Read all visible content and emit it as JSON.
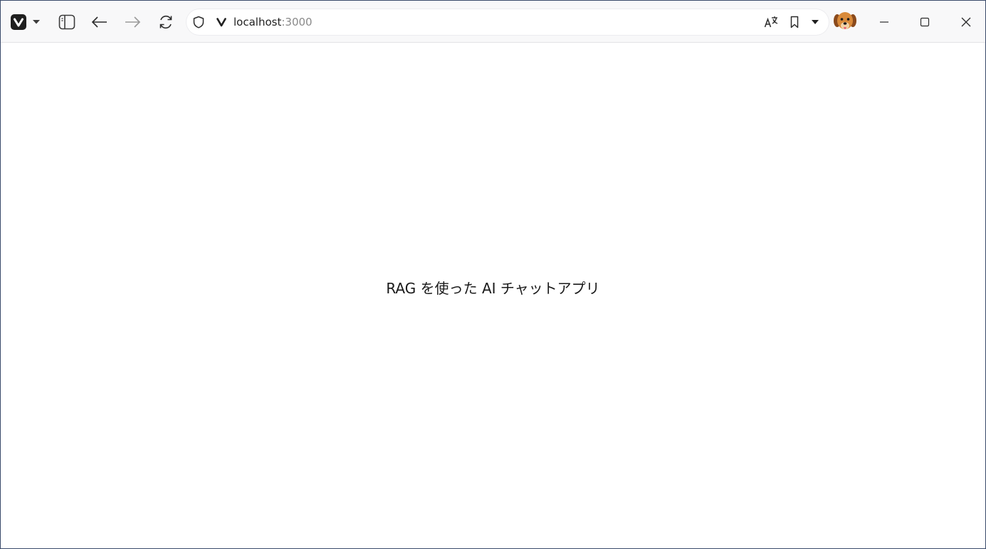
{
  "browser": {
    "address": {
      "host": "localhost",
      "port": ":3000"
    },
    "icons": {
      "menu": "vivaldi-logo-icon",
      "menu_dropdown": "chevron-down-icon",
      "panel": "panel-toggle-icon",
      "back": "arrow-left-icon",
      "forward": "arrow-right-icon",
      "reload": "reload-icon",
      "site_info": "shield-icon",
      "site_logo": "vivaldi-v-icon",
      "translate": "translate-icon",
      "bookmark": "bookmark-icon",
      "bookmark_dropdown": "caret-down-icon",
      "profile": "dog-avatar-icon",
      "minimize": "minimize-icon",
      "maximize": "maximize-icon",
      "close": "close-icon"
    }
  },
  "page": {
    "heading": "RAG を使った AI チャットアプリ"
  },
  "colors": {
    "toolbar_bg": "#f8f8f9",
    "window_border": "#3a4a6a",
    "text": "#1a1a1a",
    "url_port": "#8a8a8a"
  }
}
